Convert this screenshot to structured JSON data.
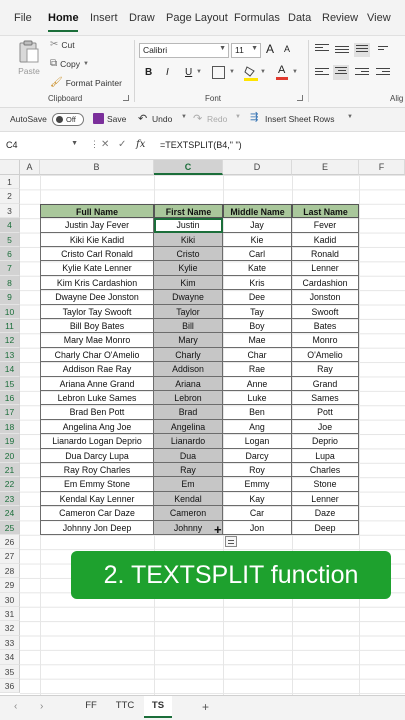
{
  "menu": {
    "tabs": [
      "File",
      "Home",
      "Insert",
      "Draw",
      "Page Layout",
      "Formulas",
      "Data",
      "Review",
      "View"
    ],
    "active": "Home"
  },
  "ribbon": {
    "paste": "Paste",
    "cut": "Cut",
    "copy": "Copy",
    "format_painter": "Format Painter",
    "clipboard_label": "Clipboard",
    "font_name": "Calibri",
    "font_size": "11",
    "font_label": "Font",
    "bold": "B",
    "italic": "I",
    "underline": "U",
    "grow_font": "A",
    "shrink_font": "A",
    "alignment_label": "Alig",
    "accent_color": "#1b6e3a",
    "font_color_bar": "#e03a2f"
  },
  "qat": {
    "autosave": "AutoSave",
    "autosave_state": "Off",
    "save": "Save",
    "undo": "Undo",
    "redo": "Redo",
    "insert_rows": "Insert Sheet Rows"
  },
  "formula_bar": {
    "name_box": "C4",
    "formula": "=TEXTSPLIT(B4,\" \")"
  },
  "grid": {
    "columns": [
      "A",
      "B",
      "C",
      "D",
      "E",
      "F"
    ],
    "selected_column": "C",
    "selected_rows": [
      4,
      25
    ],
    "rows": [
      "1",
      "2",
      "3",
      "4",
      "5",
      "6",
      "7",
      "8",
      "9",
      "10",
      "11",
      "12",
      "13",
      "14",
      "15",
      "16",
      "17",
      "18",
      "19",
      "20",
      "21",
      "22",
      "23",
      "24",
      "25",
      "26",
      "27",
      "28",
      "29",
      "30",
      "31",
      "32",
      "33",
      "34",
      "35",
      "36"
    ]
  },
  "table": {
    "headers": [
      "Full Name",
      "First Name",
      "Middle Name",
      "Last Name"
    ],
    "header_color": "#a9c79b",
    "rows": [
      [
        "Justin Jay Fever",
        "Justin",
        "Jay",
        "Fever"
      ],
      [
        "Kiki Kie Kadid",
        "Kiki",
        "Kie",
        "Kadid"
      ],
      [
        "Cristo Carl Ronald",
        "Cristo",
        "Carl",
        "Ronald"
      ],
      [
        "Kylie Kate Lenner",
        "Kylie",
        "Kate",
        "Lenner"
      ],
      [
        "Kim Kris Cardashion",
        "Kim",
        "Kris",
        "Cardashion"
      ],
      [
        "Dwayne Dee Jonston",
        "Dwayne",
        "Dee",
        "Jonston"
      ],
      [
        "Taylor Tay Swooft",
        "Taylor",
        "Tay",
        "Swooft"
      ],
      [
        "Bill Boy Bates",
        "Bill",
        "Boy",
        "Bates"
      ],
      [
        "Mary Mae Monro",
        "Mary",
        "Mae",
        "Monro"
      ],
      [
        "Charly Char O'Amelio",
        "Charly",
        "Char",
        "O'Amelio"
      ],
      [
        "Addison Rae Ray",
        "Addison",
        "Rae",
        "Ray"
      ],
      [
        "Ariana Anne Grand",
        "Ariana",
        "Anne",
        "Grand"
      ],
      [
        "Lebron Luke Sames",
        "Lebron",
        "Luke",
        "Sames"
      ],
      [
        "Brad Ben Pott",
        "Brad",
        "Ben",
        "Pott"
      ],
      [
        "Angelina Ang Joe",
        "Angelina",
        "Ang",
        "Joe"
      ],
      [
        "Lianardo Logan Deprio",
        "Lianardo",
        "Logan",
        "Deprio"
      ],
      [
        "Dua Darcy Lupa",
        "Dua",
        "Darcy",
        "Lupa"
      ],
      [
        "Ray Roy Charles",
        "Ray",
        "Roy",
        "Charles"
      ],
      [
        "Em Emmy Stone",
        "Em",
        "Emmy",
        "Stone"
      ],
      [
        "Kendal Kay Lenner",
        "Kendal",
        "Kay",
        "Lenner"
      ],
      [
        "Cameron Car Daze",
        "Cameron",
        "Car",
        "Daze"
      ],
      [
        "Johnny Jon Deep",
        "Johnny",
        "Jon",
        "Deep"
      ]
    ]
  },
  "banner": {
    "text": "2. TEXTSPLIT function",
    "color": "#1ea12e"
  },
  "sheets": {
    "tabs": [
      "FF",
      "TTC",
      "TS"
    ],
    "active": "TS"
  }
}
